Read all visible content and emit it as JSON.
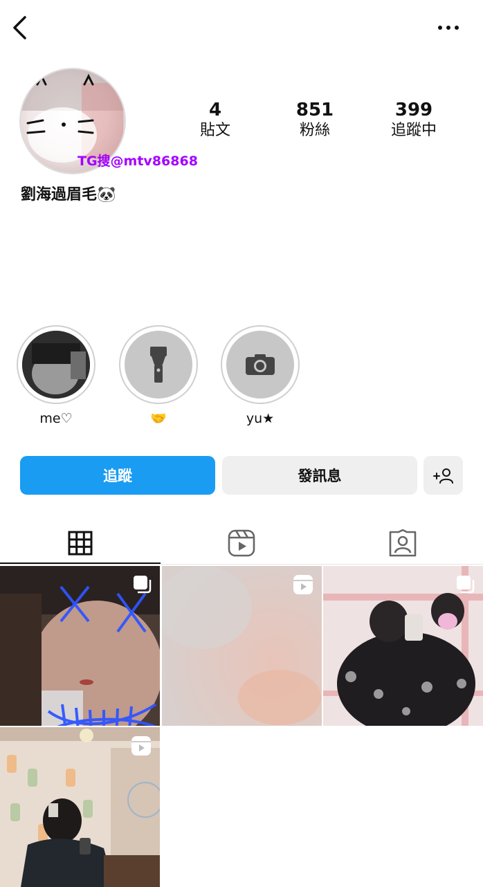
{
  "header": {
    "back_icon": "chevron-left-icon",
    "more_icon": "more-horizontal-icon"
  },
  "profile": {
    "watermark": "TG搜@mtv86868",
    "bio": "劉海過眉毛🐼",
    "stats": [
      {
        "value": "4",
        "label": "貼文"
      },
      {
        "value": "851",
        "label": "粉絲"
      },
      {
        "value": "399",
        "label": "追蹤中"
      }
    ]
  },
  "highlights": [
    {
      "label": "me♡",
      "icon": "photo-thumbnail"
    },
    {
      "label": "🤝",
      "icon": "flashlight-icon"
    },
    {
      "label": "yu★",
      "icon": "camera-icon"
    }
  ],
  "actions": {
    "follow": "追蹤",
    "message": "發訊息",
    "add_user_icon": "add-user-icon"
  },
  "tabs": [
    {
      "icon": "grid-icon",
      "active": true
    },
    {
      "icon": "reels-icon",
      "active": false
    },
    {
      "icon": "tagged-icon",
      "active": false
    }
  ],
  "posts": [
    {
      "type": "carousel",
      "badge_icon": "multi-image-icon"
    },
    {
      "type": "reel",
      "badge_icon": "reels-icon"
    },
    {
      "type": "carousel",
      "badge_icon": "multi-image-icon"
    },
    {
      "type": "reel",
      "badge_icon": "reels-icon"
    }
  ],
  "colors": {
    "accent": "#1a9cf2",
    "watermark": "#a400ff",
    "button_gray": "#efefef"
  }
}
